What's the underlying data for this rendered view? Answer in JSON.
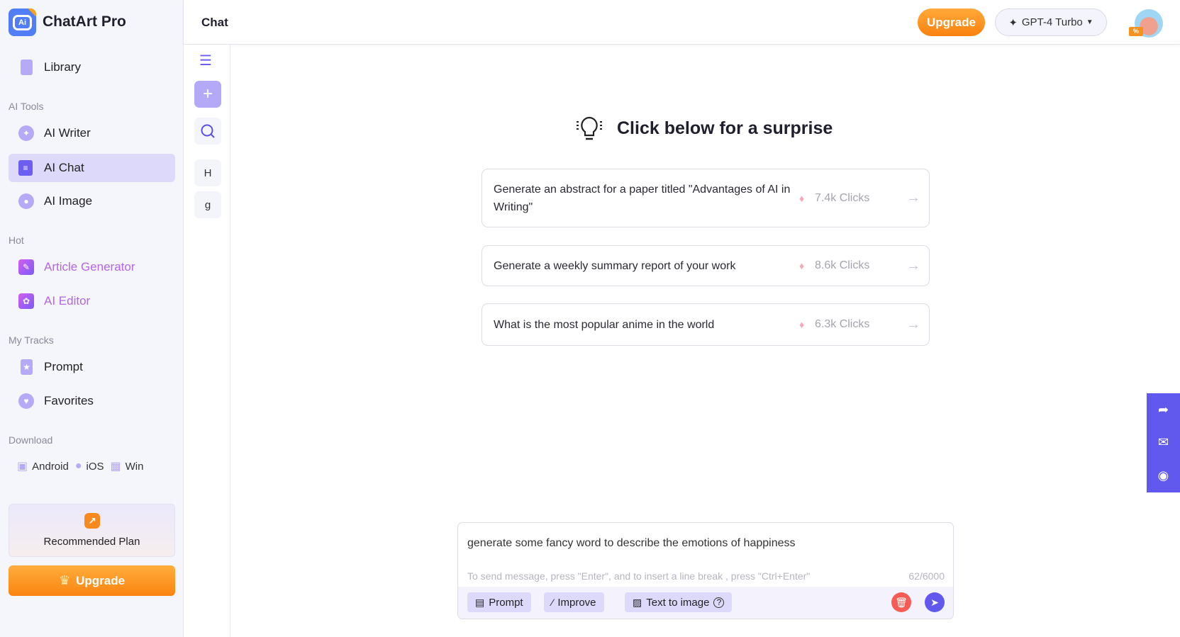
{
  "app": {
    "name": "ChatArt Pro",
    "logo_text": "Ai"
  },
  "sidebar": {
    "library": "Library",
    "sections": {
      "ai_tools": "AI Tools",
      "hot": "Hot",
      "my_tracks": "My Tracks",
      "download": "Download"
    },
    "ai_tools": [
      {
        "label": "AI Writer",
        "icon": "bulb-icon"
      },
      {
        "label": "AI Chat",
        "icon": "chat-icon",
        "active": true
      },
      {
        "label": "AI Image",
        "icon": "palette-icon"
      }
    ],
    "hot": [
      {
        "label": "Article Generator",
        "icon": "article-icon"
      },
      {
        "label": "AI Editor",
        "icon": "atom-icon"
      }
    ],
    "my_tracks": [
      {
        "label": "Prompt",
        "icon": "prompt-icon"
      },
      {
        "label": "Favorites",
        "icon": "heart-icon"
      }
    ],
    "downloads": [
      "Android",
      "iOS",
      "Win"
    ],
    "recommended_plan": "Recommended Plan",
    "upgrade": "Upgrade"
  },
  "header": {
    "title": "Chat",
    "upgrade": "Upgrade",
    "model": "GPT-4 Turbo",
    "avatar_badge": "%"
  },
  "history": {
    "items": [
      "H",
      "g"
    ]
  },
  "main": {
    "heading": "Click below for a surprise",
    "suggestions": [
      {
        "text": "Generate an abstract for a paper titled \"Advantages of AI in Writing\"",
        "clicks": "7.4k Clicks"
      },
      {
        "text": "Generate a weekly summary report of your work",
        "clicks": "8.6k Clicks"
      },
      {
        "text": "What is the most popular anime in the world",
        "clicks": "6.3k Clicks"
      }
    ]
  },
  "composer": {
    "value": "generate some fancy word to describe the emotions of happiness",
    "hint": "To send message, press \"Enter\", and to insert a line break , press \"Ctrl+Enter\"",
    "count": "62/6000",
    "buttons": {
      "prompt": "Prompt",
      "improve": "Improve",
      "text_to_image": "Text to image"
    }
  },
  "colors": {
    "accent": "#6159ee",
    "upgrade": "#fb840f",
    "active_bg": "#dcd9fb",
    "delete": "#f65b55"
  }
}
